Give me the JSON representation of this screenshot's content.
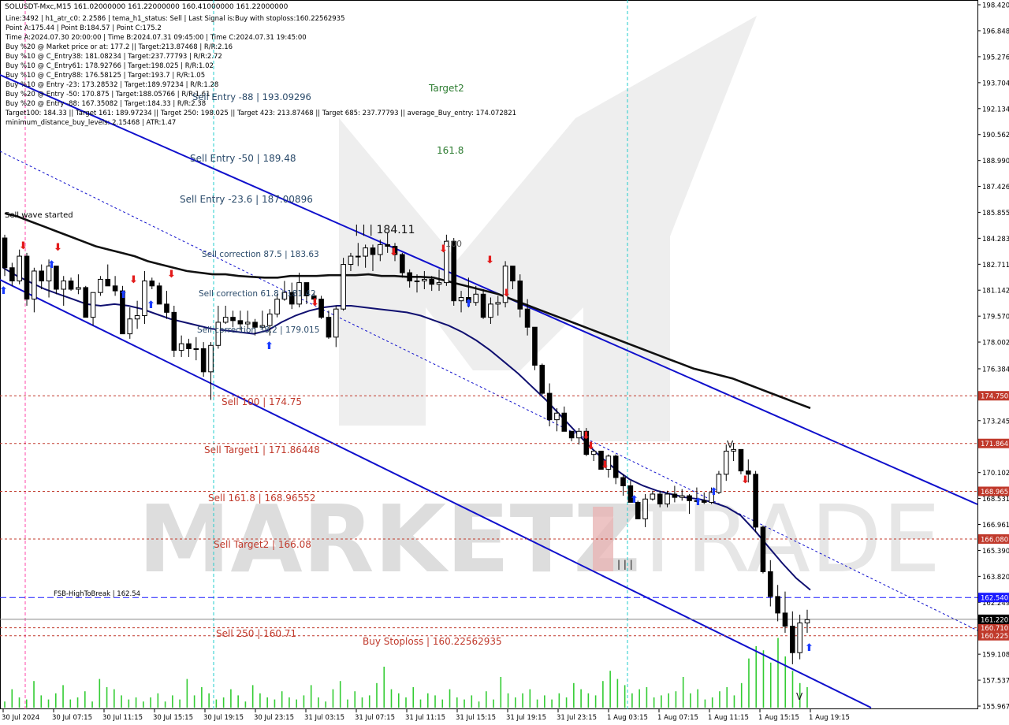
{
  "chart_data": {
    "type": "candlestick",
    "symbol_line": "SOLUSDT-Mxc,M15  161.02000000 161.22000000 160.41000000 161.22000000",
    "info_lines": [
      "Line:3492  |  h1_atr_c0: 2.2586  |  tema_h1_status: Sell  |  Last Signal is:Buy with stoploss:160.22562935",
      "Point A:175.44  |  Point B:184.57  |  Point C:175.2",
      "Time A:2024.07.30 20:00:00  |  Time B:2024.07.31 09:45:00  |  Time C:2024.07.31 19:45:00",
      "Buy %20 @ Market price or at: 177.2  ||  Target:213.87468  |  R/R:2.16",
      "Buy %10 @ C_Entry38: 181.08234  |  Target:237.77793  |  R/R:2.72",
      "Buy %10 @ C_Entry61: 178.92766  |  Target:198.025  |  R/R:1.02",
      "Buy %10 @ C_Entry88: 176.58125  |  Target:193.7  |  R/R:1.05",
      "Buy %10 @ Entry -23: 173.28532  |  Target:189.97234  |  R/R:1.28",
      "Buy %20 @ Entry -50: 170.875  |  Target:188.05766  |  R/R:1.61",
      "Buy %20 @ Entry -88: 167.35082  |  Target:184.33  |  R/R:2.38",
      "Target100: 184.33  ||  Target 161: 189.97234  ||  Target 250: 198.025  ||  Target 423: 213.87468  ||  Target 685: 237.77793  ||  average_Buy_entry: 174.072821",
      "minimum_distance_buy_levels: 2.15468  |  ATR:1.47"
    ],
    "y_ticks": [
      "198.420",
      "196.848",
      "195.276",
      "193.704",
      "192.134",
      "190.562",
      "188.990",
      "187.426",
      "185.855",
      "184.283",
      "182.711",
      "181.142",
      "179.570",
      "178.002",
      "176.384",
      "174.750",
      "173.245",
      "171.864",
      "170.102",
      "168.965",
      "168.531",
      "166.961",
      "166.080",
      "165.390",
      "163.820",
      "162.540",
      "162.249",
      "161.220",
      "160.710",
      "160.225",
      "159.108",
      "157.537",
      "155.967"
    ],
    "ylim": [
      155.967,
      198.42
    ],
    "x_ticks": [
      "30 Jul 2024",
      "30 Jul 07:15",
      "30 Jul 11:15",
      "30 Jul 15:15",
      "30 Jul 19:15",
      "30 Jul 23:15",
      "31 Jul 03:15",
      "31 Jul 07:15",
      "31 Jul 11:15",
      "31 Jul 15:15",
      "31 Jul 19:15",
      "31 Jul 23:15",
      "1 Aug 03:15",
      "1 Aug 07:15",
      "1 Aug 11:15",
      "1 Aug 15:15",
      "1 Aug 19:15"
    ],
    "levels": [
      {
        "label": "Sell 100 | 174.75",
        "value": 174.75,
        "tag": "174.750",
        "color": "#c0392b"
      },
      {
        "label": "Sell Target1 | 171.86448",
        "value": 171.86448,
        "tag": "171.864",
        "color": "#c0392b"
      },
      {
        "label": "Sell 161.8 | 168.96552",
        "value": 168.96552,
        "tag": "168.965",
        "color": "#c0392b"
      },
      {
        "label": "Sell Target2 | 166.08",
        "value": 166.08,
        "tag": "166.080",
        "color": "#c0392b"
      },
      {
        "label": "FSB-HighToBreak | 162.54",
        "value": 162.54,
        "tag": "162.540",
        "color": "#1a1aff"
      },
      {
        "label": "Sell 250 | 160.71",
        "value": 160.71,
        "tag": "160.710",
        "color": "#c0392b"
      },
      {
        "label": "Buy Stoploss | 160.22562935",
        "value": 160.22562935,
        "tag": "160.225",
        "color": "#c0392b"
      }
    ],
    "current_price": {
      "value": 161.22,
      "tag": "161.220"
    },
    "annotations": [
      "Sell Entry -88 | 193.09296",
      "Sell Entry -50 | 189.48",
      "Sell Entry -23.6 | 187.00896",
      "Sell wave started",
      "Sell correction 87.5 | 183.63",
      "Sell correction 61.8 | 181.42",
      "Sell correction 38.2 | 179.015",
      "Target2",
      "161.8",
      "| | | 184.11",
      "100",
      "| | |",
      "V"
    ],
    "candles": [
      [
        184.3,
        184.5,
        182.0,
        182.5
      ],
      [
        182.5,
        182.8,
        181.4,
        181.7
      ],
      [
        181.7,
        183.6,
        181.5,
        183.2
      ],
      [
        183.2,
        183.4,
        180.2,
        180.6
      ],
      [
        180.6,
        182.5,
        179.8,
        182.3
      ],
      [
        182.3,
        182.7,
        181.2,
        181.7
      ],
      [
        181.7,
        183.0,
        180.7,
        182.6
      ],
      [
        182.6,
        182.6,
        180.9,
        181.2
      ],
      [
        181.2,
        182.0,
        180.2,
        181.7
      ],
      [
        181.7,
        181.9,
        181.1,
        181.2
      ],
      [
        181.2,
        182.1,
        180.9,
        181.3
      ],
      [
        181.3,
        181.4,
        179.5,
        179.5
      ],
      [
        179.5,
        181.0,
        179.0,
        181.0
      ],
      [
        181.0,
        182.0,
        180.8,
        181.8
      ],
      [
        181.8,
        182.7,
        181.4,
        181.4
      ],
      [
        181.4,
        182.0,
        180.8,
        181.1
      ],
      [
        181.1,
        181.4,
        178.5,
        178.5
      ],
      [
        178.5,
        180.1,
        178.2,
        179.4
      ],
      [
        179.4,
        180.5,
        178.8,
        179.6
      ],
      [
        179.6,
        182.3,
        179.1,
        181.7
      ],
      [
        181.7,
        181.9,
        181.2,
        181.4
      ],
      [
        181.4,
        181.6,
        180.3,
        180.3
      ],
      [
        180.3,
        181.1,
        179.4,
        179.8
      ],
      [
        179.8,
        180.2,
        177.1,
        177.5
      ],
      [
        177.5,
        178.4,
        177.1,
        177.9
      ],
      [
        177.9,
        178.2,
        177.1,
        177.6
      ],
      [
        177.6,
        178.3,
        176.9,
        177.6
      ],
      [
        177.6,
        178.0,
        175.9,
        176.2
      ],
      [
        176.2,
        178.0,
        174.5,
        177.8
      ],
      [
        177.8,
        180.2,
        177.6,
        179.2
      ],
      [
        179.2,
        180.2,
        179.1,
        179.5
      ],
      [
        179.5,
        179.9,
        178.9,
        179.3
      ],
      [
        179.3,
        179.9,
        178.7,
        179.1
      ],
      [
        179.1,
        179.9,
        178.8,
        179.2
      ],
      [
        179.2,
        179.4,
        178.4,
        178.9
      ],
      [
        178.9,
        179.9,
        178.8,
        179.0
      ],
      [
        179.0,
        180.0,
        178.4,
        179.7
      ],
      [
        179.7,
        180.9,
        179.5,
        180.6
      ],
      [
        180.6,
        181.7,
        180.5,
        181.0
      ],
      [
        181.0,
        181.6,
        180.0,
        180.3
      ],
      [
        180.3,
        182.2,
        180.1,
        181.6
      ],
      [
        181.6,
        181.6,
        180.3,
        180.8
      ],
      [
        180.8,
        181.0,
        180.4,
        180.6
      ],
      [
        180.6,
        180.8,
        179.4,
        179.5
      ],
      [
        179.5,
        179.9,
        178.2,
        178.3
      ],
      [
        178.3,
        180.2,
        177.7,
        180.0
      ],
      [
        180.0,
        183.1,
        179.9,
        182.7
      ],
      [
        182.7,
        183.4,
        182.3,
        183.2
      ],
      [
        183.2,
        184.0,
        182.6,
        183.2
      ],
      [
        183.2,
        183.9,
        182.5,
        183.7
      ],
      [
        183.7,
        183.9,
        182.3,
        183.3
      ],
      [
        183.3,
        184.2,
        182.9,
        183.9
      ],
      [
        183.9,
        184.6,
        183.4,
        183.8
      ],
      [
        183.8,
        184.0,
        182.9,
        183.3
      ],
      [
        183.3,
        183.4,
        181.9,
        182.2
      ],
      [
        182.2,
        182.4,
        181.3,
        181.7
      ],
      [
        181.7,
        182.1,
        181.0,
        181.7
      ],
      [
        181.7,
        182.3,
        181.2,
        181.8
      ],
      [
        181.8,
        182.0,
        181.1,
        181.5
      ],
      [
        181.5,
        182.4,
        181.1,
        181.6
      ],
      [
        181.6,
        184.5,
        181.4,
        184.1
      ],
      [
        184.1,
        184.3,
        180.2,
        180.5
      ],
      [
        180.5,
        181.1,
        179.8,
        180.7
      ],
      [
        180.7,
        181.9,
        180.1,
        180.4
      ],
      [
        180.4,
        181.4,
        180.2,
        180.9
      ],
      [
        180.9,
        181.2,
        179.4,
        179.5
      ],
      [
        179.5,
        180.7,
        179.1,
        180.3
      ],
      [
        180.3,
        180.8,
        179.6,
        180.4
      ],
      [
        180.4,
        182.9,
        180.1,
        182.6
      ],
      [
        182.6,
        182.6,
        181.2,
        181.7
      ],
      [
        181.7,
        182.1,
        179.5,
        180.0
      ],
      [
        180.0,
        180.6,
        178.4,
        178.9
      ],
      [
        178.9,
        178.9,
        176.3,
        176.6
      ],
      [
        176.6,
        176.7,
        174.8,
        174.9
      ],
      [
        174.9,
        175.5,
        172.9,
        173.3
      ],
      [
        173.3,
        174.0,
        172.6,
        173.7
      ],
      [
        173.7,
        174.1,
        172.6,
        172.6
      ],
      [
        172.6,
        172.6,
        172.0,
        172.2
      ],
      [
        172.2,
        172.8,
        171.8,
        172.6
      ],
      [
        172.6,
        172.8,
        171.1,
        171.2
      ],
      [
        171.2,
        171.4,
        170.8,
        171.4
      ],
      [
        171.4,
        171.4,
        170.3,
        170.3
      ],
      [
        170.3,
        171.2,
        169.8,
        171.1
      ],
      [
        171.1,
        171.2,
        169.4,
        169.8
      ],
      [
        169.8,
        170.0,
        168.7,
        169.3
      ],
      [
        169.3,
        169.6,
        168.3,
        168.3
      ],
      [
        168.3,
        168.4,
        167.3,
        167.3
      ],
      [
        167.3,
        168.8,
        166.8,
        168.5
      ],
      [
        168.5,
        169.0,
        168.4,
        168.8
      ],
      [
        168.8,
        169.0,
        168.0,
        168.2
      ],
      [
        168.2,
        169.0,
        168.0,
        168.8
      ],
      [
        168.8,
        169.3,
        168.3,
        168.6
      ],
      [
        168.6,
        169.1,
        168.4,
        168.7
      ],
      [
        168.7,
        168.8,
        167.6,
        168.4
      ],
      [
        168.4,
        169.2,
        168.3,
        168.4
      ],
      [
        168.4,
        168.9,
        168.2,
        168.3
      ],
      [
        168.3,
        169.2,
        168.2,
        168.9
      ],
      [
        168.9,
        170.2,
        168.8,
        170.0
      ],
      [
        170.0,
        171.8,
        169.6,
        171.4
      ],
      [
        171.4,
        171.9,
        170.8,
        171.5
      ],
      [
        171.5,
        171.5,
        170.0,
        170.2
      ],
      [
        170.2,
        170.9,
        169.5,
        170.0
      ],
      [
        170.0,
        170.2,
        166.5,
        166.8
      ],
      [
        166.8,
        166.9,
        164.0,
        164.1
      ],
      [
        164.1,
        164.8,
        162.0,
        162.6
      ],
      [
        162.6,
        163.3,
        161.1,
        161.6
      ],
      [
        161.6,
        162.9,
        160.4,
        160.8
      ],
      [
        160.8,
        161.7,
        158.5,
        159.2
      ],
      [
        159.2,
        161.5,
        158.8,
        161.0
      ],
      [
        161.0,
        161.8,
        160.4,
        161.2
      ]
    ],
    "ma_black": [
      185.8,
      185.6,
      185.3,
      185.0,
      184.7,
      184.4,
      184.1,
      183.8,
      183.6,
      183.4,
      183.2,
      182.9,
      182.7,
      182.5,
      182.3,
      182.2,
      182.1,
      182.1,
      182.0,
      181.95,
      181.9,
      181.9,
      182.0,
      182.0,
      182.0,
      182.05,
      182.05,
      182.05,
      182.1,
      182.0,
      182.0,
      181.95,
      181.95,
      181.9,
      181.7,
      181.5,
      181.3,
      181.1,
      180.9,
      180.6,
      180.3,
      180.0,
      179.7,
      179.4,
      179.1,
      178.8,
      178.5,
      178.2,
      177.9,
      177.6,
      177.3,
      177.0,
      176.7,
      176.4,
      176.2,
      176.0,
      175.8,
      175.5,
      175.2,
      174.9,
      174.6,
      174.3,
      174.0
    ],
    "ma_navy": [
      182.5,
      182.0,
      181.6,
      181.2,
      180.9,
      180.6,
      180.3,
      180.2,
      180.3,
      180.2,
      180.0,
      179.7,
      179.4,
      179.2,
      179.0,
      178.8,
      178.7,
      178.6,
      178.5,
      178.7,
      179.2,
      179.6,
      179.9,
      180.1,
      180.2,
      180.2,
      180.1,
      180.0,
      179.9,
      179.8,
      179.6,
      179.3,
      179.0,
      178.6,
      178.1,
      177.5,
      176.8,
      176.1,
      175.3,
      174.5,
      173.6,
      172.7,
      171.8,
      171.0,
      170.3,
      169.7,
      169.3,
      169.0,
      168.8,
      168.6,
      168.5,
      168.3,
      168.0,
      167.5,
      166.6,
      165.6,
      164.6,
      163.7,
      163.0
    ],
    "volumes": [
      3,
      9,
      5,
      4,
      13,
      6,
      4,
      7,
      11,
      4,
      5,
      8,
      3,
      14,
      10,
      9,
      6,
      4,
      5,
      3,
      5,
      7,
      3,
      6,
      4,
      14,
      6,
      10,
      7,
      4,
      5,
      9,
      6,
      3,
      11,
      7,
      5,
      4,
      8,
      5,
      4,
      6,
      11,
      5,
      3,
      9,
      13,
      4,
      8,
      5,
      6,
      12,
      20,
      9,
      7,
      5,
      10,
      4,
      7,
      6,
      4,
      9,
      5,
      4,
      6,
      3,
      8,
      4,
      15,
      7,
      5,
      7,
      9,
      4,
      6,
      4,
      7,
      5,
      12,
      9,
      7,
      6,
      13,
      18,
      14,
      11,
      7,
      9,
      10,
      5,
      6,
      7,
      8,
      15,
      7,
      9,
      4,
      5,
      8,
      10,
      6,
      12,
      24,
      30,
      28,
      22,
      34,
      25,
      18,
      12,
      10
    ]
  }
}
